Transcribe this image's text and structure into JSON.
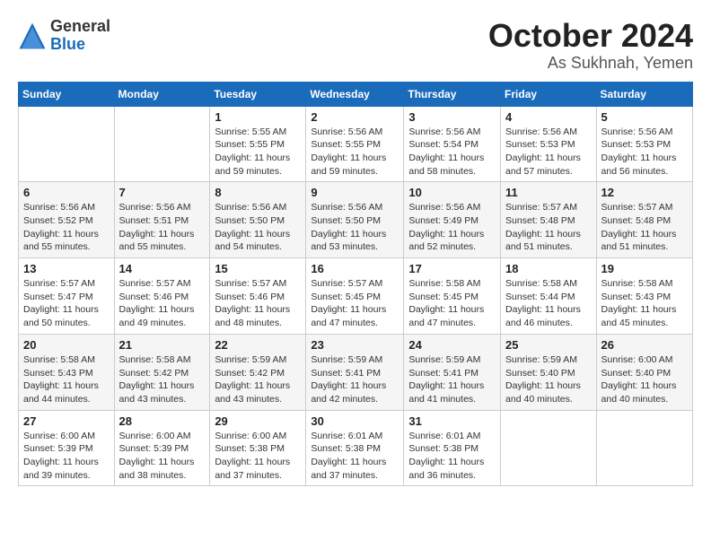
{
  "logo": {
    "general": "General",
    "blue": "Blue"
  },
  "title": "October 2024",
  "location": "As Sukhnah, Yemen",
  "headers": [
    "Sunday",
    "Monday",
    "Tuesday",
    "Wednesday",
    "Thursday",
    "Friday",
    "Saturday"
  ],
  "rows": [
    [
      {
        "day": "",
        "info": ""
      },
      {
        "day": "",
        "info": ""
      },
      {
        "day": "1",
        "info": "Sunrise: 5:55 AM\nSunset: 5:55 PM\nDaylight: 11 hours and 59 minutes."
      },
      {
        "day": "2",
        "info": "Sunrise: 5:56 AM\nSunset: 5:55 PM\nDaylight: 11 hours and 59 minutes."
      },
      {
        "day": "3",
        "info": "Sunrise: 5:56 AM\nSunset: 5:54 PM\nDaylight: 11 hours and 58 minutes."
      },
      {
        "day": "4",
        "info": "Sunrise: 5:56 AM\nSunset: 5:53 PM\nDaylight: 11 hours and 57 minutes."
      },
      {
        "day": "5",
        "info": "Sunrise: 5:56 AM\nSunset: 5:53 PM\nDaylight: 11 hours and 56 minutes."
      }
    ],
    [
      {
        "day": "6",
        "info": "Sunrise: 5:56 AM\nSunset: 5:52 PM\nDaylight: 11 hours and 55 minutes."
      },
      {
        "day": "7",
        "info": "Sunrise: 5:56 AM\nSunset: 5:51 PM\nDaylight: 11 hours and 55 minutes."
      },
      {
        "day": "8",
        "info": "Sunrise: 5:56 AM\nSunset: 5:50 PM\nDaylight: 11 hours and 54 minutes."
      },
      {
        "day": "9",
        "info": "Sunrise: 5:56 AM\nSunset: 5:50 PM\nDaylight: 11 hours and 53 minutes."
      },
      {
        "day": "10",
        "info": "Sunrise: 5:56 AM\nSunset: 5:49 PM\nDaylight: 11 hours and 52 minutes."
      },
      {
        "day": "11",
        "info": "Sunrise: 5:57 AM\nSunset: 5:48 PM\nDaylight: 11 hours and 51 minutes."
      },
      {
        "day": "12",
        "info": "Sunrise: 5:57 AM\nSunset: 5:48 PM\nDaylight: 11 hours and 51 minutes."
      }
    ],
    [
      {
        "day": "13",
        "info": "Sunrise: 5:57 AM\nSunset: 5:47 PM\nDaylight: 11 hours and 50 minutes."
      },
      {
        "day": "14",
        "info": "Sunrise: 5:57 AM\nSunset: 5:46 PM\nDaylight: 11 hours and 49 minutes."
      },
      {
        "day": "15",
        "info": "Sunrise: 5:57 AM\nSunset: 5:46 PM\nDaylight: 11 hours and 48 minutes."
      },
      {
        "day": "16",
        "info": "Sunrise: 5:57 AM\nSunset: 5:45 PM\nDaylight: 11 hours and 47 minutes."
      },
      {
        "day": "17",
        "info": "Sunrise: 5:58 AM\nSunset: 5:45 PM\nDaylight: 11 hours and 47 minutes."
      },
      {
        "day": "18",
        "info": "Sunrise: 5:58 AM\nSunset: 5:44 PM\nDaylight: 11 hours and 46 minutes."
      },
      {
        "day": "19",
        "info": "Sunrise: 5:58 AM\nSunset: 5:43 PM\nDaylight: 11 hours and 45 minutes."
      }
    ],
    [
      {
        "day": "20",
        "info": "Sunrise: 5:58 AM\nSunset: 5:43 PM\nDaylight: 11 hours and 44 minutes."
      },
      {
        "day": "21",
        "info": "Sunrise: 5:58 AM\nSunset: 5:42 PM\nDaylight: 11 hours and 43 minutes."
      },
      {
        "day": "22",
        "info": "Sunrise: 5:59 AM\nSunset: 5:42 PM\nDaylight: 11 hours and 43 minutes."
      },
      {
        "day": "23",
        "info": "Sunrise: 5:59 AM\nSunset: 5:41 PM\nDaylight: 11 hours and 42 minutes."
      },
      {
        "day": "24",
        "info": "Sunrise: 5:59 AM\nSunset: 5:41 PM\nDaylight: 11 hours and 41 minutes."
      },
      {
        "day": "25",
        "info": "Sunrise: 5:59 AM\nSunset: 5:40 PM\nDaylight: 11 hours and 40 minutes."
      },
      {
        "day": "26",
        "info": "Sunrise: 6:00 AM\nSunset: 5:40 PM\nDaylight: 11 hours and 40 minutes."
      }
    ],
    [
      {
        "day": "27",
        "info": "Sunrise: 6:00 AM\nSunset: 5:39 PM\nDaylight: 11 hours and 39 minutes."
      },
      {
        "day": "28",
        "info": "Sunrise: 6:00 AM\nSunset: 5:39 PM\nDaylight: 11 hours and 38 minutes."
      },
      {
        "day": "29",
        "info": "Sunrise: 6:00 AM\nSunset: 5:38 PM\nDaylight: 11 hours and 37 minutes."
      },
      {
        "day": "30",
        "info": "Sunrise: 6:01 AM\nSunset: 5:38 PM\nDaylight: 11 hours and 37 minutes."
      },
      {
        "day": "31",
        "info": "Sunrise: 6:01 AM\nSunset: 5:38 PM\nDaylight: 11 hours and 36 minutes."
      },
      {
        "day": "",
        "info": ""
      },
      {
        "day": "",
        "info": ""
      }
    ]
  ]
}
